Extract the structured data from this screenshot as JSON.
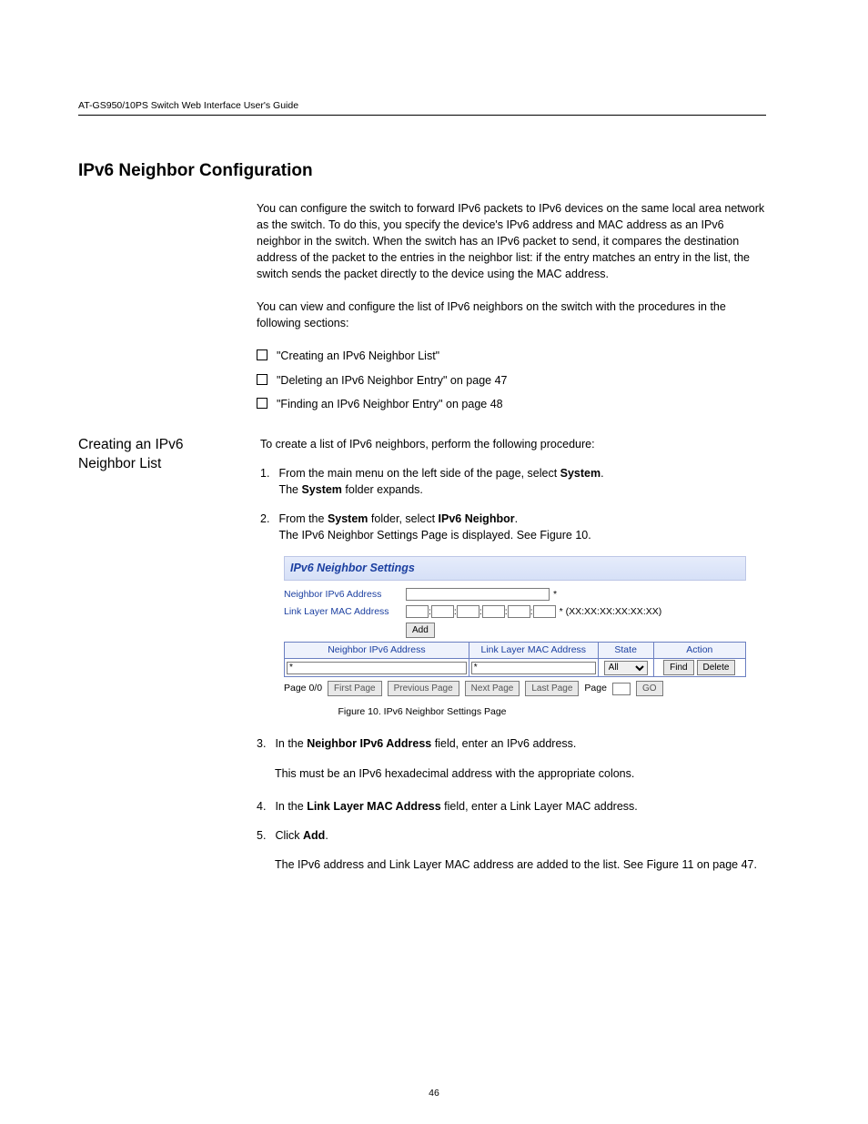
{
  "header": {
    "guide": "AT-GS950/10PS Switch Web Interface User's Guide"
  },
  "title": "IPv6 Neighbor Configuration",
  "intro": "You can configure the switch to forward IPv6 packets to IPv6 devices on the same local area network as the switch. To do this, you specify the device's IPv6 address and MAC address as an IPv6 neighbor in the switch. When the switch has an IPv6 packet to send, it compares the destination address of the packet to the entries in the neighbor list: if the entry matches an entry in the list, the switch sends the packet directly to the device using the MAC address.",
  "intro2": "You can view and configure the list of IPv6 neighbors on the switch with the procedures in the following sections:",
  "toc": [
    "\"Creating an IPv6 Neighbor List\"",
    "\"Deleting an IPv6 Neighbor Entry\" on page 47",
    "\"Finding an IPv6 Neighbor Entry\" on page 48"
  ],
  "section": {
    "title": "Creating an IPv6 Neighbor List",
    "steps_intro": "To create a list of IPv6 neighbors, perform the following procedure:",
    "step1_num": "1.",
    "step1": "From the main menu on the left side of the page, select System. The System folder expands.",
    "step2_num": "2.",
    "step2_a": "From the System folder, select IPv6 Neighbor.",
    "step2_b": "The IPv6 Neighbor Settings Page is displayed. See Figure 10."
  },
  "screenshot": {
    "panel_title": "IPv6 Neighbor Settings",
    "row1_label": "Neighbor IPv6 Address",
    "row1_star": "*",
    "row2_label": "Link Layer MAC Address",
    "row2_hint": "* (XX:XX:XX:XX:XX:XX)",
    "add_button": "Add",
    "table": {
      "col1": "Neighbor IPv6 Address",
      "col2": "Link Layer MAC Address",
      "col3": "State",
      "col4": "Action",
      "filter1": "*",
      "filter2": "*",
      "state_select": "All",
      "find": "Find",
      "delete": "Delete"
    },
    "pager": {
      "page_label": "Page 0/0",
      "first": "First Page",
      "prev": "Previous Page",
      "next": "Next Page",
      "last": "Last Page",
      "page_word": "Page",
      "go": "GO"
    }
  },
  "figure_caption": "Figure 10. IPv6 Neighbor Settings Page",
  "after1_num": "3.",
  "after1": "In the Neighbor IPv6 Address field, enter an IPv6 address.",
  "after2": "This must be an IPv6 hexadecimal address with the appropriate colons.",
  "after3_num": "4.",
  "after3": "In the Link Layer MAC Address field, enter a Link Layer MAC address.",
  "after4_num": "5.",
  "after4": "Click Add.",
  "after5": "The IPv6 address and Link Layer MAC address are added to the list. See Figure 11 on page 47.",
  "footer": "46"
}
